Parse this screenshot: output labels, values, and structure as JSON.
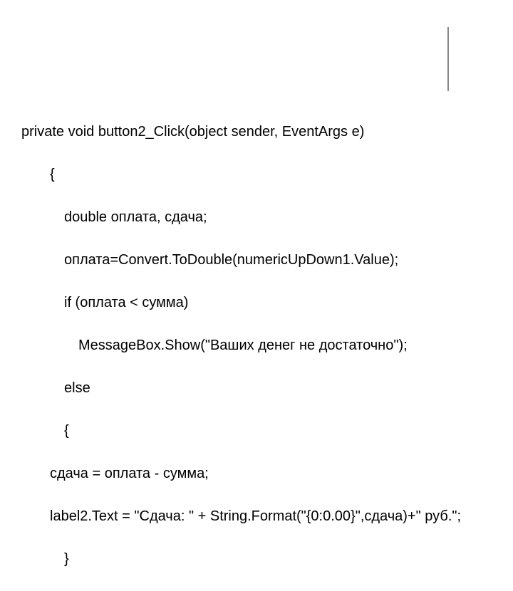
{
  "code": {
    "l0": "private void button2_Click(object sender, EventArgs e)",
    "l1": "{",
    "l2": "double оплата, сдача;",
    "l3": "оплата=Convert.ToDouble(numericUpDown1.Value);",
    "l4": "if (оплата < сумма)",
    "l5": "MessageBox.Show(\"Ваших денег не достаточно\");",
    "l6": "else",
    "l7": "{",
    "l8": "сдача = оплата - сумма;",
    "l9": "label2.Text = \"Сдача: \" + String.Format(\"{0:0.00}\",сдача)+\" руб.\";",
    "l10": "}"
  }
}
